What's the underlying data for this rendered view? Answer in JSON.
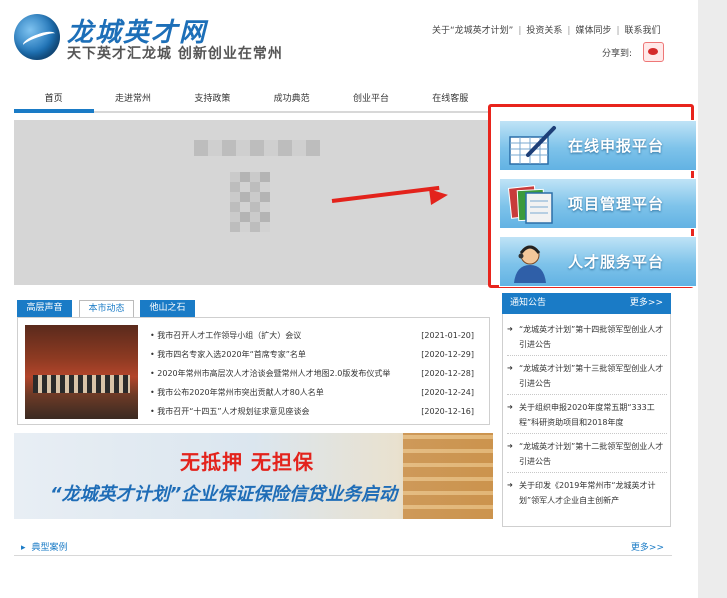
{
  "header": {
    "logo_title": "龙城英才网",
    "logo_slogan": "天下英才汇龙城  创新创业在常州",
    "top_links": [
      "关于“龙城英才计划”",
      "投资关系",
      "媒体同步",
      "联系我们"
    ],
    "share_label": "分享到:"
  },
  "nav": {
    "items": [
      "首页",
      "走进常州",
      "支持政策",
      "成功典范",
      "创业平台",
      "在线客服"
    ]
  },
  "platforms": [
    {
      "label": "在线申报平台",
      "icon": "pen-spreadsheet-icon"
    },
    {
      "label": "项目管理平台",
      "icon": "folders-icon"
    },
    {
      "label": "人才服务平台",
      "icon": "service-agent-icon"
    }
  ],
  "news": {
    "tabs": [
      "高层声音",
      "本市动态",
      "他山之石"
    ],
    "items": [
      {
        "title": "• 我市召开人才工作领导小组（扩大）会议",
        "date": "[2021-01-20]"
      },
      {
        "title": "• 我市四名专家入选2020年“首席专家”名单",
        "date": "[2020-12-29]"
      },
      {
        "title": "• 2020年常州市高层次人才洽谈会暨常州人才地图2.0版发布仪式举",
        "date": "[2020-12-28]"
      },
      {
        "title": "• 我市公布2020年常州市突出贡献人才80人名单",
        "date": "[2020-12-24]"
      },
      {
        "title": "• 我市召开“十四五”人才规划征求意见座谈会",
        "date": "[2020-12-16]"
      }
    ]
  },
  "ad": {
    "line1": "无抵押 无担保",
    "line2": "“龙城英才计划”企业保证保险信贷业务启动"
  },
  "notices": {
    "title": "通知公告",
    "more": "更多>>",
    "items": [
      "“龙城英才计划”第十四批领军型创业人才引进公告",
      "“龙城英才计划”第十三批领军型创业人才引进公告",
      "关于组织申报2020年度常五期“333工程”科研资助项目和2018年度",
      "“龙城英才计划”第十二批领军型创业人才引进公告",
      "关于印发《2019年常州市“龙城英才计划”领军人才企业自主创新产"
    ]
  },
  "cases": {
    "title": "典型案例",
    "more": "更多>>"
  },
  "colors": {
    "brand_blue": "#1a7bc6",
    "highlight_red": "#e8241c"
  }
}
